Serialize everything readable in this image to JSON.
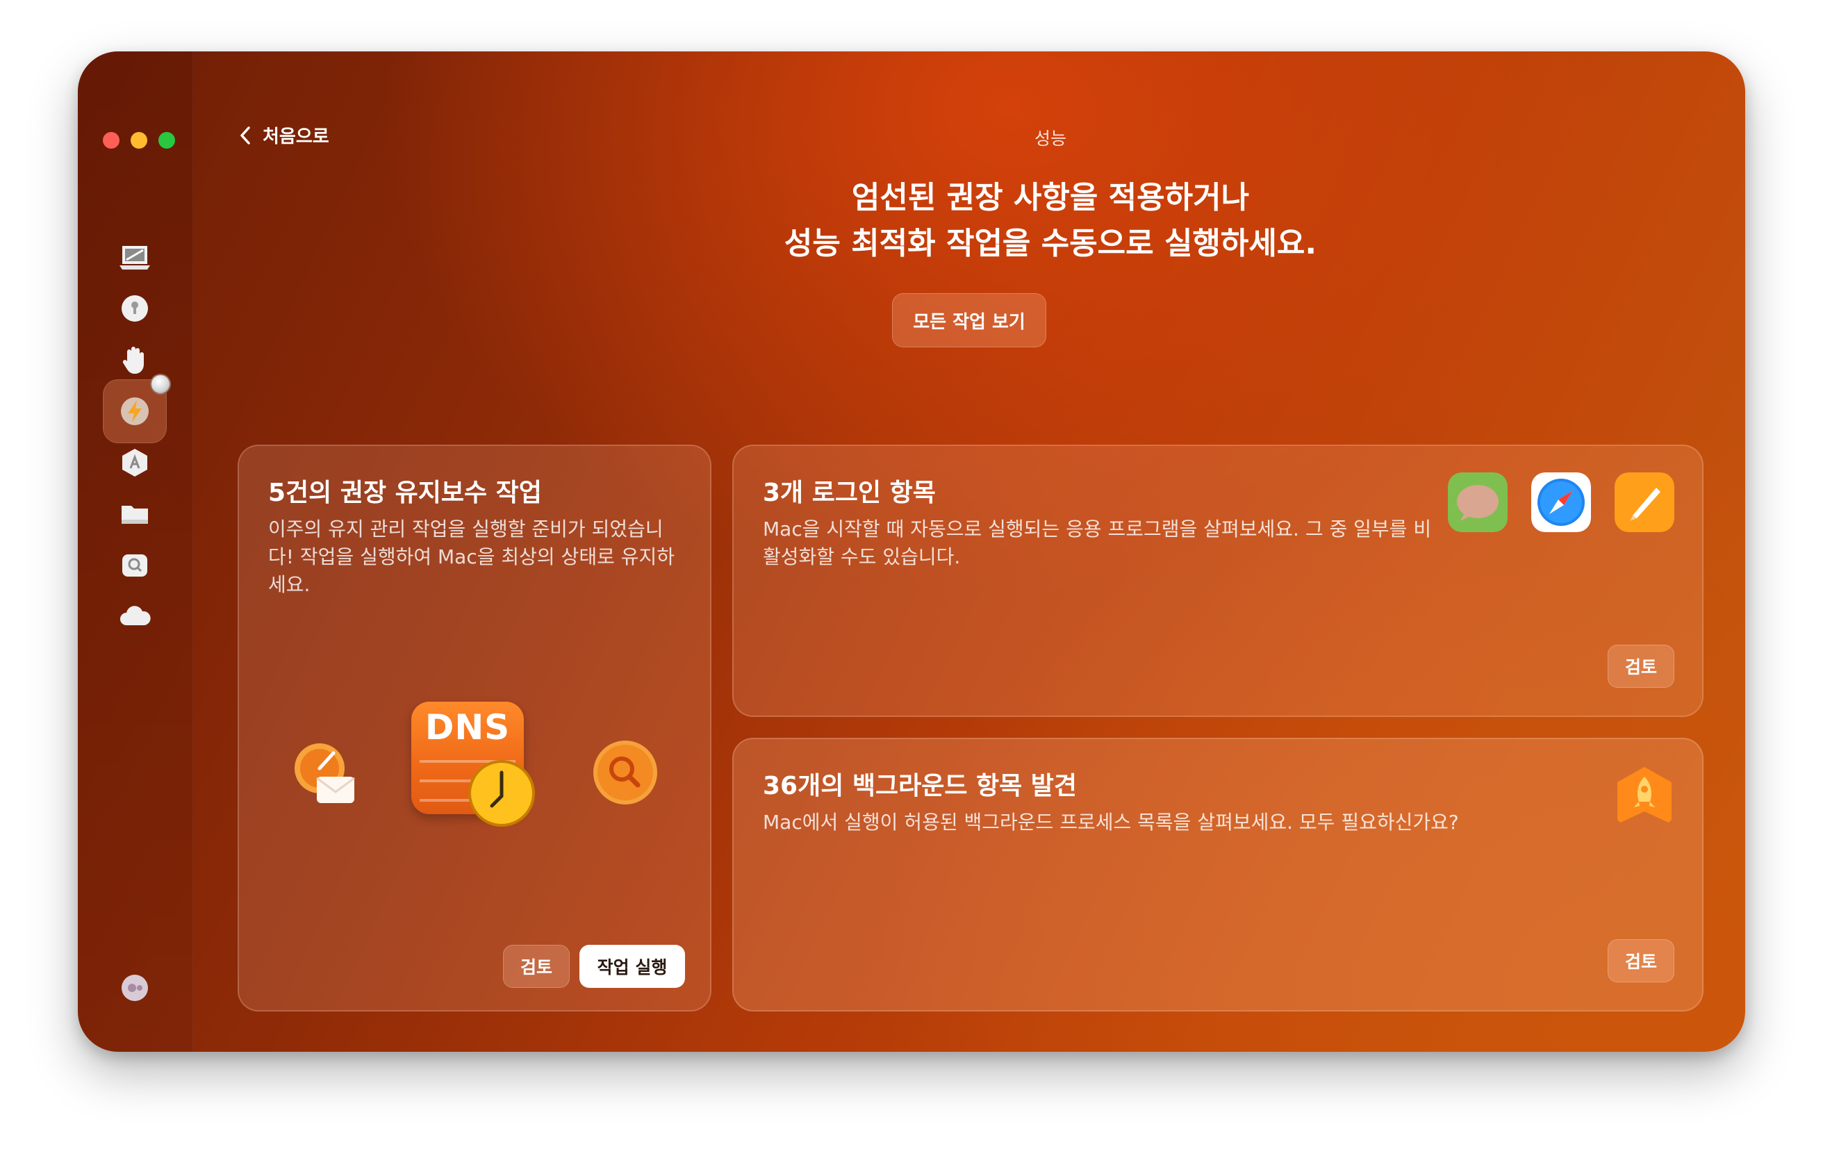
{
  "window": {
    "title": "성능",
    "back_label": "처음으로"
  },
  "sidebar": {
    "items": [
      {
        "name": "cleanup",
        "icon": "monitor-icon"
      },
      {
        "name": "protection",
        "icon": "shield-icon"
      },
      {
        "name": "privacy",
        "icon": "hand-icon"
      },
      {
        "name": "performance",
        "icon": "lightning-icon",
        "active": true
      },
      {
        "name": "applications",
        "icon": "apps-icon"
      },
      {
        "name": "my-clutter",
        "icon": "folder-icon"
      },
      {
        "name": "space-lens",
        "icon": "lens-icon"
      },
      {
        "name": "cloud",
        "icon": "cloud-icon"
      }
    ],
    "assistant_icon": "assistant-icon"
  },
  "hero": {
    "line1": "엄선된 권장 사항을 적용하거나",
    "line2": "성능 최적화 작업을 수동으로 실행하세요.",
    "view_all_label": "모든 작업 보기"
  },
  "cards": {
    "maintenance": {
      "title": "5건의 권장 유지보수 작업",
      "description": "이주의 유지 관리 작업을 실행할 준비가 되었습니다! 작업을 실행하여 Mac을 최상의 상태로 유지하세요.",
      "dns_label": "DNS",
      "review_label": "검토",
      "run_label": "작업 실행"
    },
    "login": {
      "title": "3개 로그인 항목",
      "description": "Mac을 시작할 때 자동으로 실행되는 응용 프로그램을 살펴보세요. 그 중 일부를 비활성화할 수도 있습니다.",
      "review_label": "검토",
      "apps": [
        "messages-icon",
        "safari-icon",
        "pages-icon"
      ]
    },
    "background": {
      "title": "36개의 백그라운드 항목 발견",
      "description": "Mac에서 실행이 허용된 백그라운드 프로세스 목록을 살펴보세요. 모두 필요하신가요?",
      "review_label": "검토"
    }
  },
  "colors": {
    "accent": "#c2470a",
    "traffic_red": "#ff5f57",
    "traffic_yellow": "#febc2e",
    "traffic_green": "#28c840"
  }
}
